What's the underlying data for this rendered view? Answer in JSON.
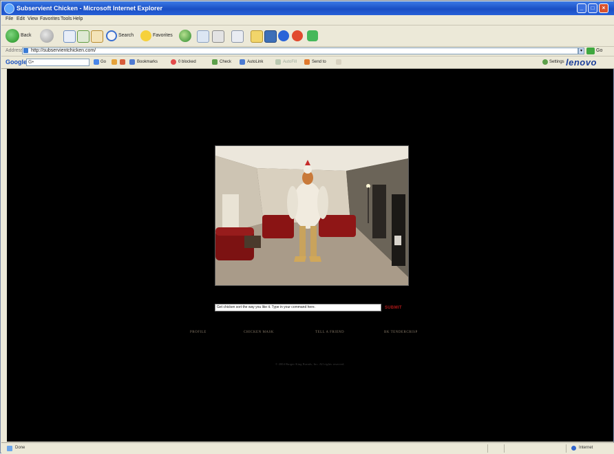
{
  "window": {
    "title": "Subservient Chicken - Microsoft Internet Explorer",
    "minimize": "_",
    "maximize": "□",
    "close": "×"
  },
  "menu": [
    "File",
    "Edit",
    "View",
    "Favorites",
    "Tools",
    "Help"
  ],
  "toolbar": {
    "back_label": "Back",
    "search_label": "Search",
    "favorites_label": "Favorites"
  },
  "address": {
    "label": "Address",
    "url": "http://subservientchicken.com/",
    "go_label": "Go"
  },
  "google_bar": {
    "logo": "Google",
    "search_placeholder": "G•",
    "go_label": "Go",
    "bookmarks_label": "Bookmarks",
    "blocked_label": "0 blocked",
    "check_label": "Check",
    "autolink_label": "AutoLink",
    "autofill_label": "AutoFill",
    "sendto_label": "Send to",
    "settings_label": "Settings",
    "brand": "lenovo"
  },
  "page": {
    "command_value": "Get chicken sort the way you like it. Type in your command here.",
    "submit_label": "SUBMIT",
    "nav": {
      "profile": "PROFILE",
      "mask": "CHICKEN MASK",
      "friend": "TELL A FRIEND",
      "tender": "BK TENDERCRISP"
    },
    "copyright": "© 2004 Burger King Brands, Inc. All rights reserved."
  },
  "status": {
    "text": "Done",
    "zone": "Internet"
  },
  "colors": {
    "page_bg": "#000000",
    "submit": "#b01818",
    "nav_text": "#8b7d6b",
    "titlebar": "#1b4fc4"
  }
}
